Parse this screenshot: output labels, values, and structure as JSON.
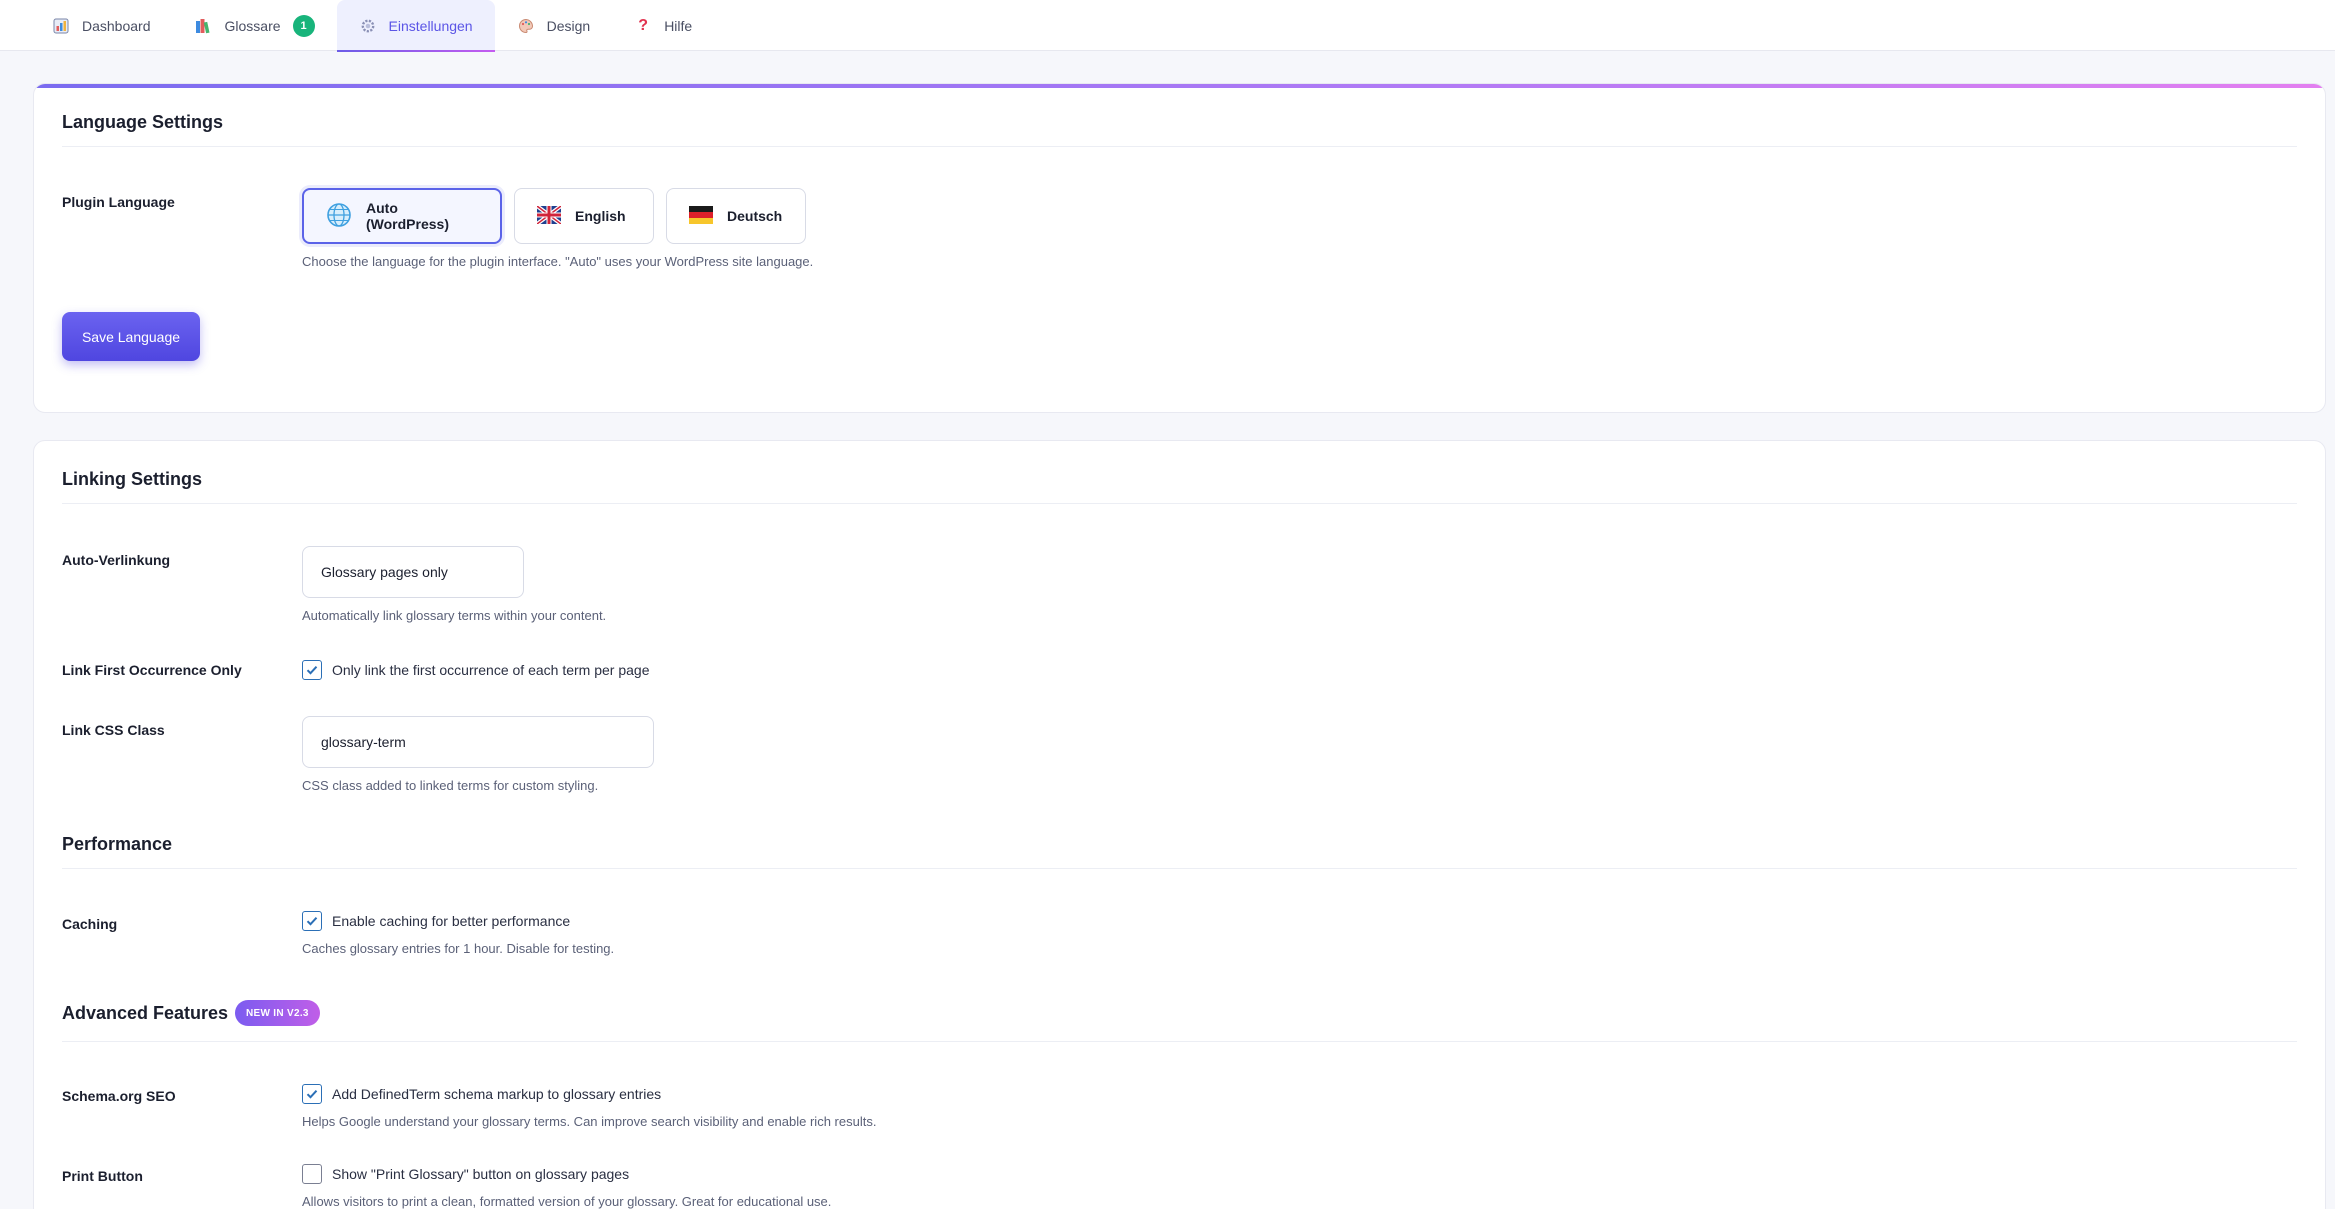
{
  "tabs": [
    {
      "label": "Dashboard",
      "icon": "bar-chart-icon"
    },
    {
      "label": "Glossare",
      "icon": "books-icon",
      "badge": "1"
    },
    {
      "label": "Einstellungen",
      "icon": "gear-icon",
      "active": true
    },
    {
      "label": "Design",
      "icon": "palette-icon"
    },
    {
      "label": "Hilfe",
      "icon": "question-icon"
    }
  ],
  "language": {
    "title": "Language Settings",
    "plugin_language_label": "Plugin Language",
    "options": [
      {
        "label": "Auto (WordPress)",
        "icon": "globe-icon",
        "selected": true
      },
      {
        "label": "English",
        "icon": "uk-flag-icon"
      },
      {
        "label": "Deutsch",
        "icon": "de-flag-icon"
      }
    ],
    "help": "Choose the language for the plugin interface. \"Auto\" uses your WordPress site language.",
    "save_label": "Save Language"
  },
  "linking": {
    "title": "Linking Settings",
    "auto_link_label": "Auto-Verlinkung",
    "auto_link_value": "Glossary pages only",
    "auto_link_help": "Automatically link glossary terms within your content.",
    "first_occ_label": "Link First Occurrence Only",
    "first_occ_text": "Only link the first occurrence of each term per page",
    "first_occ_checked": true,
    "css_class_label": "Link CSS Class",
    "css_class_value": "glossary-term",
    "css_class_help": "CSS class added to linked terms for custom styling."
  },
  "performance": {
    "title": "Performance",
    "caching_label": "Caching",
    "caching_text": "Enable caching for better performance",
    "caching_checked": true,
    "caching_help": "Caches glossary entries for 1 hour. Disable for testing."
  },
  "advanced": {
    "title": "Advanced Features",
    "badge": "NEW IN V2.3",
    "schema_label": "Schema.org SEO",
    "schema_text": "Add DefinedTerm schema markup to glossary entries",
    "schema_checked": true,
    "schema_help": "Helps Google understand your glossary terms. Can improve search visibility and enable rich results.",
    "print_label": "Print Button",
    "print_text": "Show \"Print Glossary\" button on glossary pages",
    "print_checked": false,
    "print_help": "Allows visitors to print a clean, formatted version of your glossary. Great for educational use."
  },
  "colors": {
    "accent": "#5b55e6",
    "badge_green": "#18b47b",
    "checkbox": "#2b6fb6"
  }
}
